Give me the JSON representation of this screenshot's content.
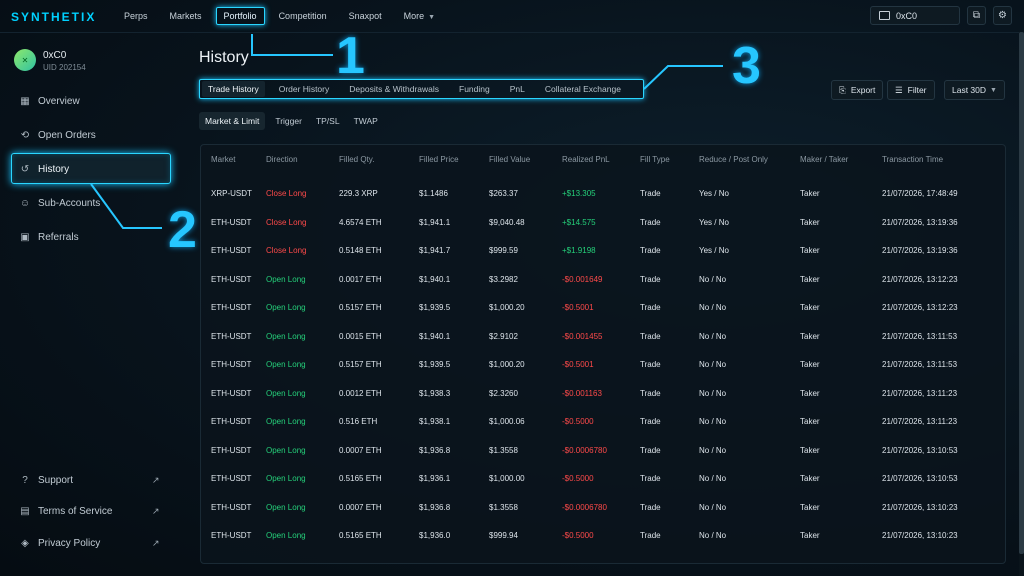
{
  "app": {
    "logo": "SYNTHETIX"
  },
  "nav": {
    "items": [
      "Perps",
      "Markets",
      "Portfolio",
      "Competition",
      "Snaxpot",
      "More"
    ],
    "active": "Portfolio"
  },
  "wallet": {
    "address": "0xC0"
  },
  "user": {
    "name": "0xC0",
    "uid": "UID 202154",
    "avatar_glyph": "✕"
  },
  "sidebar": {
    "items": [
      {
        "label": "Overview",
        "icon": "grid-icon"
      },
      {
        "label": "Open Orders",
        "icon": "orders-icon"
      },
      {
        "label": "History",
        "icon": "history-icon"
      },
      {
        "label": "Sub-Accounts",
        "icon": "users-icon"
      },
      {
        "label": "Referrals",
        "icon": "gift-icon"
      }
    ],
    "footer": [
      {
        "label": "Support",
        "icon": "help-icon"
      },
      {
        "label": "Terms of Service",
        "icon": "document-icon"
      },
      {
        "label": "Privacy Policy",
        "icon": "shield-icon"
      }
    ]
  },
  "annotations": [
    "1",
    "2",
    "3"
  ],
  "page": {
    "title": "History"
  },
  "tabs": [
    "Trade History",
    "Order History",
    "Deposits & Withdrawals",
    "Funding",
    "PnL",
    "Collateral Exchange"
  ],
  "subtabs": [
    "Market & Limit",
    "Trigger",
    "TP/SL",
    "TWAP"
  ],
  "toolbar": {
    "export": "Export",
    "filter": "Filter",
    "range": "Last 30D"
  },
  "colors": {
    "accent": "#26c6ff",
    "positive": "#25d07a",
    "negative": "#ff4a4a"
  },
  "table": {
    "headers": [
      "Market",
      "Direction",
      "Filled Qty.",
      "Filled Price",
      "Filled Value",
      "Realized PnL",
      "Fill Type",
      "Reduce / Post Only",
      "Maker / Taker",
      "Transaction Time"
    ],
    "rows": [
      [
        "XRP-USDT",
        "Close Long",
        "229.3 XRP",
        "$1.1486",
        "$263.37",
        "+$13.305",
        "Trade",
        "Yes / No",
        "Taker",
        "21/07/2026, 17:48:49"
      ],
      [
        "ETH-USDT",
        "Close Long",
        "4.6574 ETH",
        "$1,941.1",
        "$9,040.48",
        "+$14.575",
        "Trade",
        "Yes / No",
        "Taker",
        "21/07/2026, 13:19:36"
      ],
      [
        "ETH-USDT",
        "Close Long",
        "0.5148 ETH",
        "$1,941.7",
        "$999.59",
        "+$1.9198",
        "Trade",
        "Yes / No",
        "Taker",
        "21/07/2026, 13:19:36"
      ],
      [
        "ETH-USDT",
        "Open Long",
        "0.0017 ETH",
        "$1,940.1",
        "$3.2982",
        "-$0.001649",
        "Trade",
        "No / No",
        "Taker",
        "21/07/2026, 13:12:23"
      ],
      [
        "ETH-USDT",
        "Open Long",
        "0.5157 ETH",
        "$1,939.5",
        "$1,000.20",
        "-$0.5001",
        "Trade",
        "No / No",
        "Taker",
        "21/07/2026, 13:12:23"
      ],
      [
        "ETH-USDT",
        "Open Long",
        "0.0015 ETH",
        "$1,940.1",
        "$2.9102",
        "-$0.001455",
        "Trade",
        "No / No",
        "Taker",
        "21/07/2026, 13:11:53"
      ],
      [
        "ETH-USDT",
        "Open Long",
        "0.5157 ETH",
        "$1,939.5",
        "$1,000.20",
        "-$0.5001",
        "Trade",
        "No / No",
        "Taker",
        "21/07/2026, 13:11:53"
      ],
      [
        "ETH-USDT",
        "Open Long",
        "0.0012 ETH",
        "$1,938.3",
        "$2.3260",
        "-$0.001163",
        "Trade",
        "No / No",
        "Taker",
        "21/07/2026, 13:11:23"
      ],
      [
        "ETH-USDT",
        "Open Long",
        "0.516 ETH",
        "$1,938.1",
        "$1,000.06",
        "-$0.5000",
        "Trade",
        "No / No",
        "Taker",
        "21/07/2026, 13:11:23"
      ],
      [
        "ETH-USDT",
        "Open Long",
        "0.0007 ETH",
        "$1,936.8",
        "$1.3558",
        "-$0.0006780",
        "Trade",
        "No / No",
        "Taker",
        "21/07/2026, 13:10:53"
      ],
      [
        "ETH-USDT",
        "Open Long",
        "0.5165 ETH",
        "$1,936.1",
        "$1,000.00",
        "-$0.5000",
        "Trade",
        "No / No",
        "Taker",
        "21/07/2026, 13:10:53"
      ],
      [
        "ETH-USDT",
        "Open Long",
        "0.0007 ETH",
        "$1,936.8",
        "$1.3558",
        "-$0.0006780",
        "Trade",
        "No / No",
        "Taker",
        "21/07/2026, 13:10:23"
      ],
      [
        "ETH-USDT",
        "Open Long",
        "0.5165 ETH",
        "$1,936.0",
        "$999.94",
        "-$0.5000",
        "Trade",
        "No / No",
        "Taker",
        "21/07/2026, 13:10:23"
      ]
    ]
  }
}
